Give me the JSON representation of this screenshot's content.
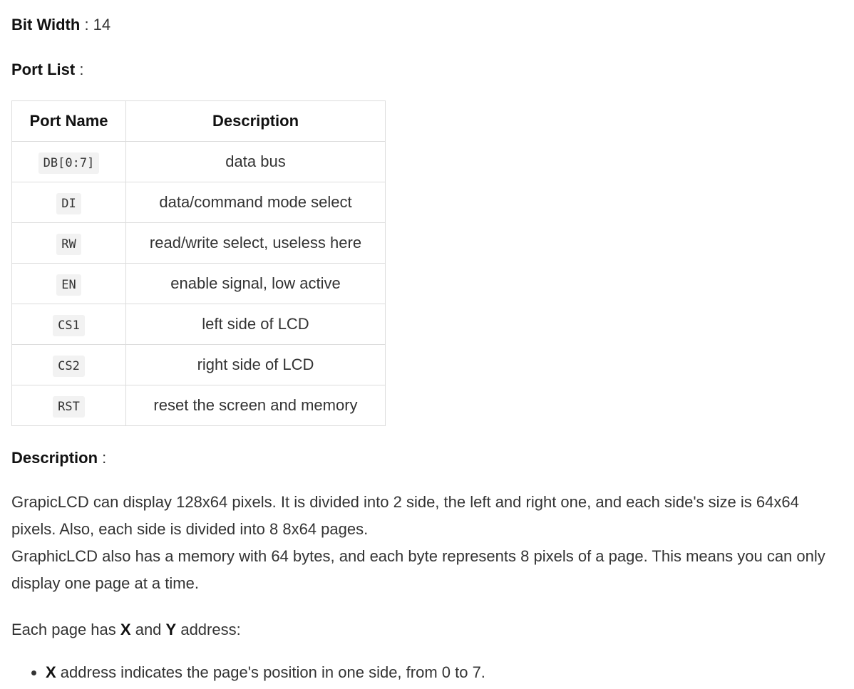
{
  "bit_width": {
    "label": "Bit Width",
    "separator": " : ",
    "value": "14"
  },
  "port_list": {
    "label": "Port List",
    "separator": " :",
    "headers": {
      "name": "Port Name",
      "description": "Description"
    },
    "rows": [
      {
        "name": "DB[0:7]",
        "description": "data bus"
      },
      {
        "name": "DI",
        "description": "data/command mode select"
      },
      {
        "name": "RW",
        "description": "read/write select, useless here"
      },
      {
        "name": "EN",
        "description": "enable signal, low active"
      },
      {
        "name": "CS1",
        "description": "left side of LCD"
      },
      {
        "name": "CS2",
        "description": "right side of LCD"
      },
      {
        "name": "RST",
        "description": "reset the screen and memory"
      }
    ]
  },
  "description": {
    "label": "Description",
    "separator": " :",
    "paragraph1_line1": "GrapicLCD can display 128x64 pixels. It is divided into 2 side, the left and right one, and each side's size is 64x64 pixels. Also, each side is divided into 8 8x64 pages.",
    "paragraph1_line2": "GraphicLCD also has a memory with 64 bytes, and each byte represents 8 pixels of a page. This means you can only display one page at a time.",
    "paragraph2": {
      "before": "Each page has ",
      "x": "X",
      "middle": " and ",
      "y": "Y",
      "after": " address:"
    },
    "bullets": [
      {
        "bold": "X",
        "text": " address indicates the page's position in one side, from 0 to 7."
      }
    ]
  }
}
